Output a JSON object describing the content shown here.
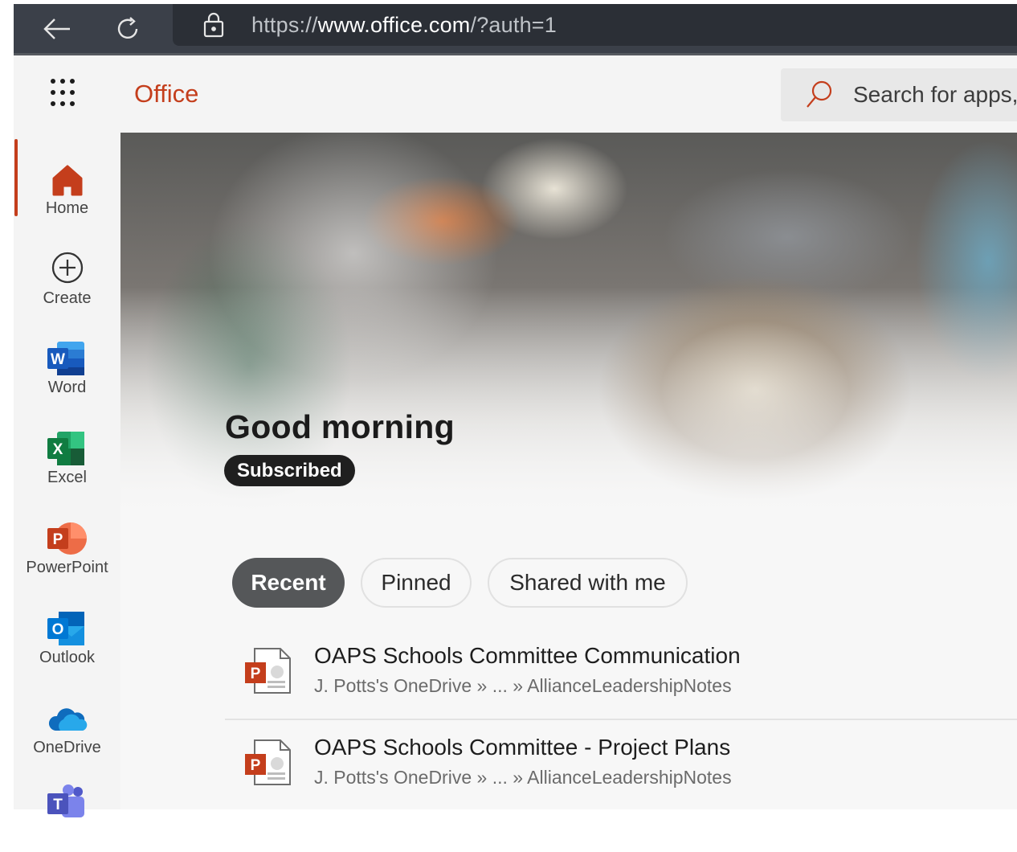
{
  "browser": {
    "url_prefix": "https://",
    "url_host": "www.office.com",
    "url_rest": "/?auth=1",
    "back_icon": "arrow-left-icon",
    "refresh_icon": "refresh-icon",
    "lock_icon": "lock-icon"
  },
  "header": {
    "brand": "Office",
    "search_placeholder": "Search for apps,",
    "brand_color": "#c43e1c"
  },
  "sidebar": {
    "items": [
      {
        "label": "Home",
        "icon": "home-icon",
        "active": true
      },
      {
        "label": "Create",
        "icon": "plus-circle-icon"
      },
      {
        "label": "Word",
        "icon": "word-icon",
        "color": "#2b579a"
      },
      {
        "label": "Excel",
        "icon": "excel-icon",
        "color": "#217346"
      },
      {
        "label": "PowerPoint",
        "icon": "powerpoint-icon",
        "color": "#d24726"
      },
      {
        "label": "Outlook",
        "icon": "outlook-icon",
        "color": "#0072c6"
      },
      {
        "label": "OneDrive",
        "icon": "onedrive-icon",
        "color": "#0364b8"
      },
      {
        "label": "Teams",
        "icon": "teams-icon",
        "color": "#5059c9"
      }
    ]
  },
  "hero": {
    "greeting": "Good morning",
    "badge": "Subscribed"
  },
  "tabs": [
    {
      "label": "Recent",
      "active": true
    },
    {
      "label": "Pinned"
    },
    {
      "label": "Shared with me"
    }
  ],
  "files": [
    {
      "title": "OAPS Schools Committee Communication",
      "path": "J. Potts's OneDrive » ... » AllianceLeadershipNotes",
      "icon": "powerpoint-file-icon"
    },
    {
      "title": "OAPS Schools Committee - Project Plans",
      "path": "J. Potts's OneDrive » ... » AllianceLeadershipNotes",
      "icon": "powerpoint-file-icon"
    }
  ]
}
